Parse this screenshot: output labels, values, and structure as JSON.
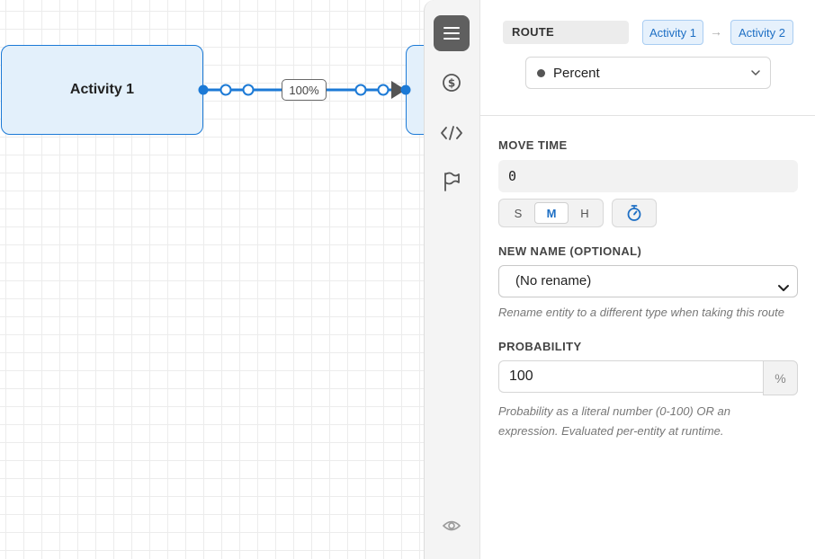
{
  "canvas": {
    "nodes": [
      {
        "label": "Activity 1"
      },
      {
        "label": ""
      }
    ],
    "edge": {
      "label": "100%"
    }
  },
  "rail": {
    "icons": [
      "menu-icon",
      "dollar-circle-icon",
      "code-icon",
      "flag-icon",
      "eye-icon"
    ]
  },
  "panel": {
    "route_tag": "ROUTE",
    "from": "Activity 1",
    "arrow": "→",
    "to": "Activity 2",
    "route_mode": "Percent",
    "move_time": {
      "label": "MOVE TIME",
      "value": "0",
      "units": [
        "S",
        "M",
        "H"
      ],
      "selected_unit": "M"
    },
    "new_name": {
      "label": "NEW NAME (OPTIONAL)",
      "value": "(No rename)",
      "hint": "Rename entity to a different type when taking this route"
    },
    "probability": {
      "label": "PROBABILITY",
      "value": "100",
      "suffix": "%",
      "hint_line1": "Probability as a literal number (0-100) OR an",
      "hint_line2": "expression. Evaluated per-entity at runtime."
    }
  },
  "colors": {
    "accent": "#1c7ad6",
    "node_fill": "#e3f0fb",
    "rail_active": "#5f5f5f"
  }
}
